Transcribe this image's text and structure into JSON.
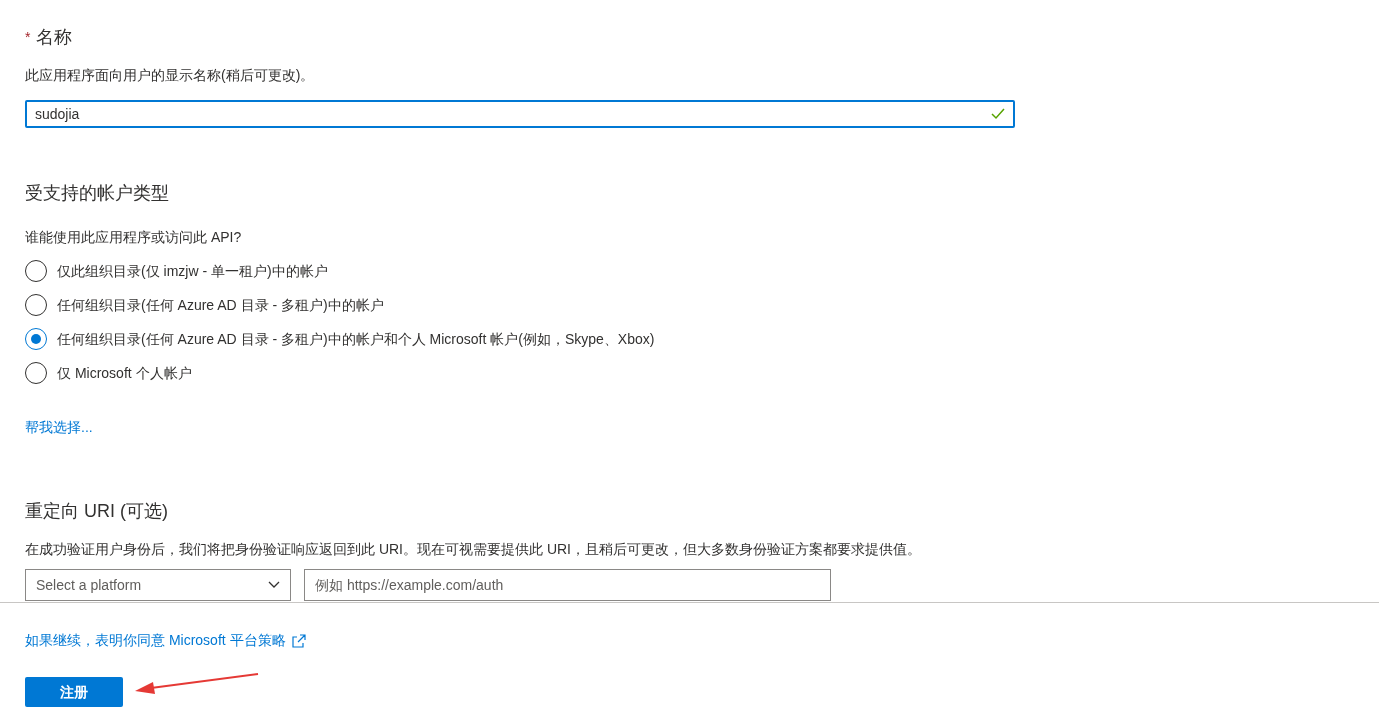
{
  "name_field": {
    "label": "名称",
    "required_mark": "*",
    "description": "此应用程序面向用户的显示名称(稍后可更改)。",
    "value": "sudojia",
    "valid": true
  },
  "account_types": {
    "title": "受支持的帐户类型",
    "question": "谁能使用此应用程序或访问此 API?",
    "options": [
      {
        "label": "仅此组织目录(仅 imzjw - 单一租户)中的帐户",
        "selected": false
      },
      {
        "label": "任何组织目录(任何 Azure AD 目录 - 多租户)中的帐户",
        "selected": false
      },
      {
        "label": "任何组织目录(任何 Azure AD 目录 - 多租户)中的帐户和个人 Microsoft 帐户(例如，Skype、Xbox)",
        "selected": true
      },
      {
        "label": "仅 Microsoft 个人帐户",
        "selected": false
      }
    ],
    "help_link": "帮我选择..."
  },
  "redirect_uri": {
    "title": "重定向 URI (可选)",
    "description": "在成功验证用户身份后，我们将把身份验证响应返回到此 URI。现在可视需要提供此 URI，且稍后可更改，但大多数身份验证方案都要求提供值。",
    "platform_placeholder": "Select a platform",
    "uri_placeholder": "例如 https://example.com/auth"
  },
  "footer": {
    "policy_link": "如果继续，表明你同意 Microsoft 平台策略",
    "register_button": "注册"
  }
}
